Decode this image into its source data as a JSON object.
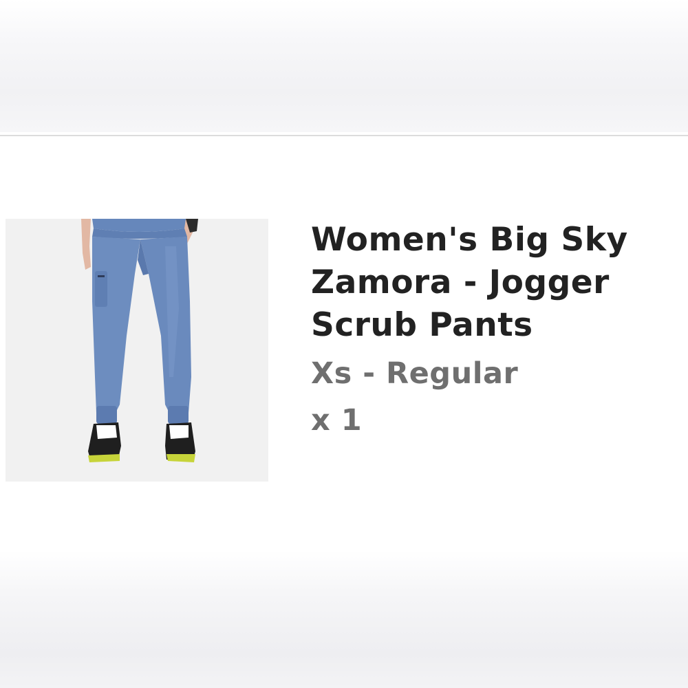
{
  "cart_item": {
    "image_subject": "model-wearing-blue-jogger-scrub-pants",
    "title": "Women's Big Sky Zamora - Jogger Scrub Pants",
    "variant": "Xs - Regular",
    "quantity": "x 1"
  },
  "colors": {
    "pants": "#6d8dbf",
    "title_text": "#222222",
    "secondary_text": "#6f6f6f",
    "image_background": "#f1f1f1"
  }
}
